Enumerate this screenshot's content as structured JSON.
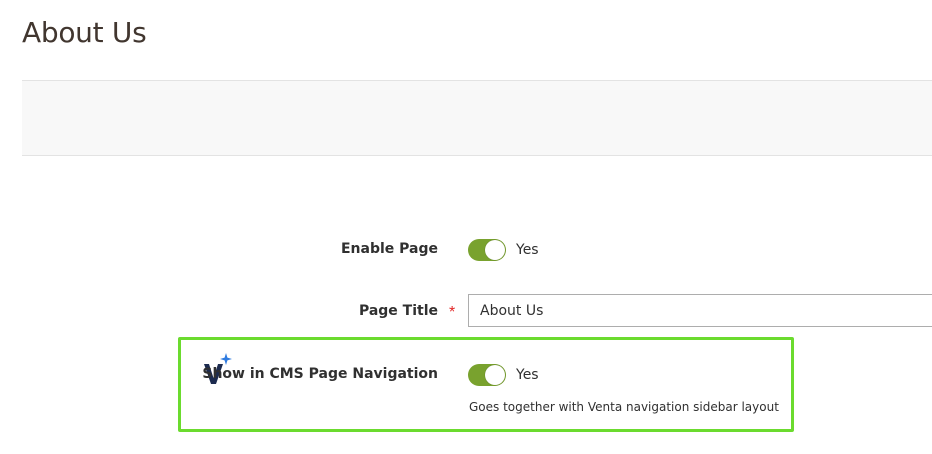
{
  "header": {
    "title": "About Us"
  },
  "form": {
    "enable_page": {
      "label": "Enable Page",
      "value_text": "Yes",
      "enabled": true
    },
    "page_title": {
      "label": "Page Title",
      "required_marker": "*",
      "value": "About Us"
    },
    "cms_navigation": {
      "label": "Show in CMS Page Navigation",
      "value_text": "Yes",
      "enabled": true,
      "note": "Goes together with Venta navigation sidebar layout",
      "logo_icon": "venta-v-sparkle-icon"
    }
  },
  "colors": {
    "toggle_on": "#79a22e",
    "highlight_border": "#6bdb2e",
    "required": "#e22626",
    "logo_dark": "#1c2b4f",
    "logo_sparkle": "#2f7be0"
  }
}
